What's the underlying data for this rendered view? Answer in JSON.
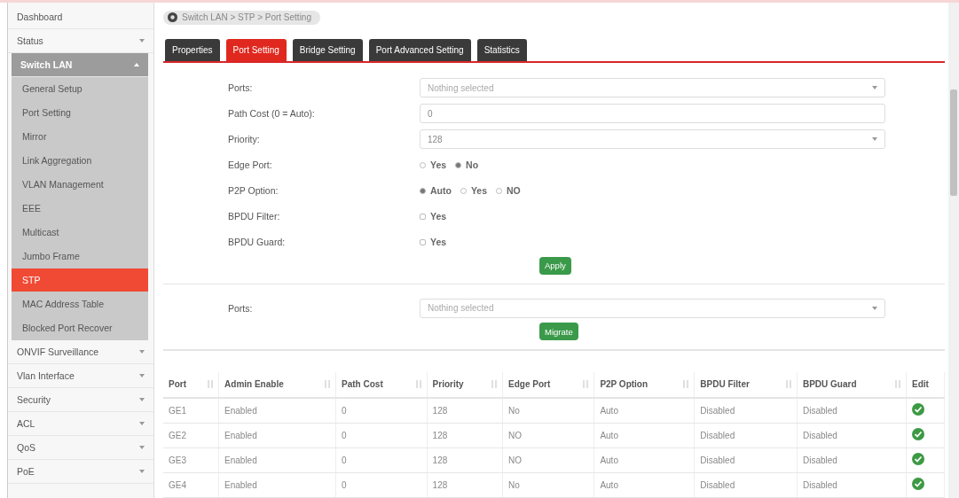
{
  "sidebar": {
    "items": [
      {
        "label": "Dashboard",
        "selected": false
      },
      {
        "label": "Status",
        "expanded": false,
        "selected": false
      },
      {
        "label": "Switch LAN",
        "expanded": true,
        "selected": false,
        "children": [
          {
            "label": "General Setup",
            "selected": false
          },
          {
            "label": "Port Setting",
            "selected": false
          },
          {
            "label": "Mirror",
            "selected": false
          },
          {
            "label": "Link Aggregation",
            "selected": false
          },
          {
            "label": "VLAN Management",
            "selected": false
          },
          {
            "label": "EEE",
            "selected": false
          },
          {
            "label": "Multicast",
            "selected": false
          },
          {
            "label": "Jumbo Frame",
            "selected": false
          },
          {
            "label": "STP",
            "selected": true
          },
          {
            "label": "MAC Address Table",
            "selected": false
          },
          {
            "label": "Blocked Port Recover",
            "selected": false
          }
        ]
      },
      {
        "label": "ONVIF Surveillance",
        "expanded": false,
        "selected": false
      },
      {
        "label": "Vlan Interface",
        "expanded": false,
        "selected": false
      },
      {
        "label": "Security",
        "expanded": false,
        "selected": false
      },
      {
        "label": "ACL",
        "expanded": false,
        "selected": false
      },
      {
        "label": "QoS",
        "expanded": false,
        "selected": false
      },
      {
        "label": "PoE",
        "expanded": false,
        "selected": false
      }
    ]
  },
  "breadcrumb": "Switch LAN > STP > Port Setting",
  "tabs": [
    {
      "label": "Properties",
      "selected": false
    },
    {
      "label": "Port Setting",
      "selected": true
    },
    {
      "label": "Bridge Setting",
      "selected": false
    },
    {
      "label": "Port Advanced Setting",
      "selected": false
    },
    {
      "label": "Statistics",
      "selected": false
    }
  ],
  "form": [
    {
      "kind": "select",
      "label": "Ports:",
      "placeholder": "Nothing selected"
    },
    {
      "kind": "input",
      "label": "Path Cost (0 = Auto):",
      "value": "0"
    },
    {
      "kind": "select",
      "label": "Priority:",
      "value": "128"
    },
    {
      "kind": "radio",
      "label": "Edge Port:",
      "options": [
        {
          "label": "Yes",
          "selected": false
        },
        {
          "label": "No",
          "selected": true
        }
      ]
    },
    {
      "kind": "radio",
      "label": "P2P Option:",
      "options": [
        {
          "label": "Auto",
          "selected": true
        },
        {
          "label": "Yes",
          "selected": false
        },
        {
          "label": "NO",
          "selected": false
        }
      ]
    },
    {
      "kind": "checkbox",
      "label": "BPDU Filter:",
      "options": [
        {
          "label": "Yes",
          "checked": false
        }
      ]
    },
    {
      "kind": "checkbox",
      "label": "BPDU Guard:",
      "options": [
        {
          "label": "Yes",
          "checked": false
        }
      ]
    }
  ],
  "apply_button": "Apply",
  "migrate": {
    "label": "Ports:",
    "placeholder": "Nothing selected",
    "button": "Migrate"
  },
  "table": {
    "columns": [
      "Port",
      "Admin Enable",
      "Path Cost",
      "Priority",
      "Edge Port",
      "P2P Option",
      "BPDU Filter",
      "BPDU Guard",
      "Edit"
    ],
    "rows": [
      [
        "GE1",
        "Enabled",
        "0",
        "128",
        "No",
        "Auto",
        "Disabled",
        "Disabled"
      ],
      [
        "GE2",
        "Enabled",
        "0",
        "128",
        "NO",
        "Auto",
        "Disabled",
        "Disabled"
      ],
      [
        "GE3",
        "Enabled",
        "0",
        "128",
        "NO",
        "Auto",
        "Disabled",
        "Disabled"
      ],
      [
        "GE4",
        "Enabled",
        "0",
        "128",
        "No",
        "Auto",
        "Disabled",
        "Disabled"
      ]
    ]
  }
}
